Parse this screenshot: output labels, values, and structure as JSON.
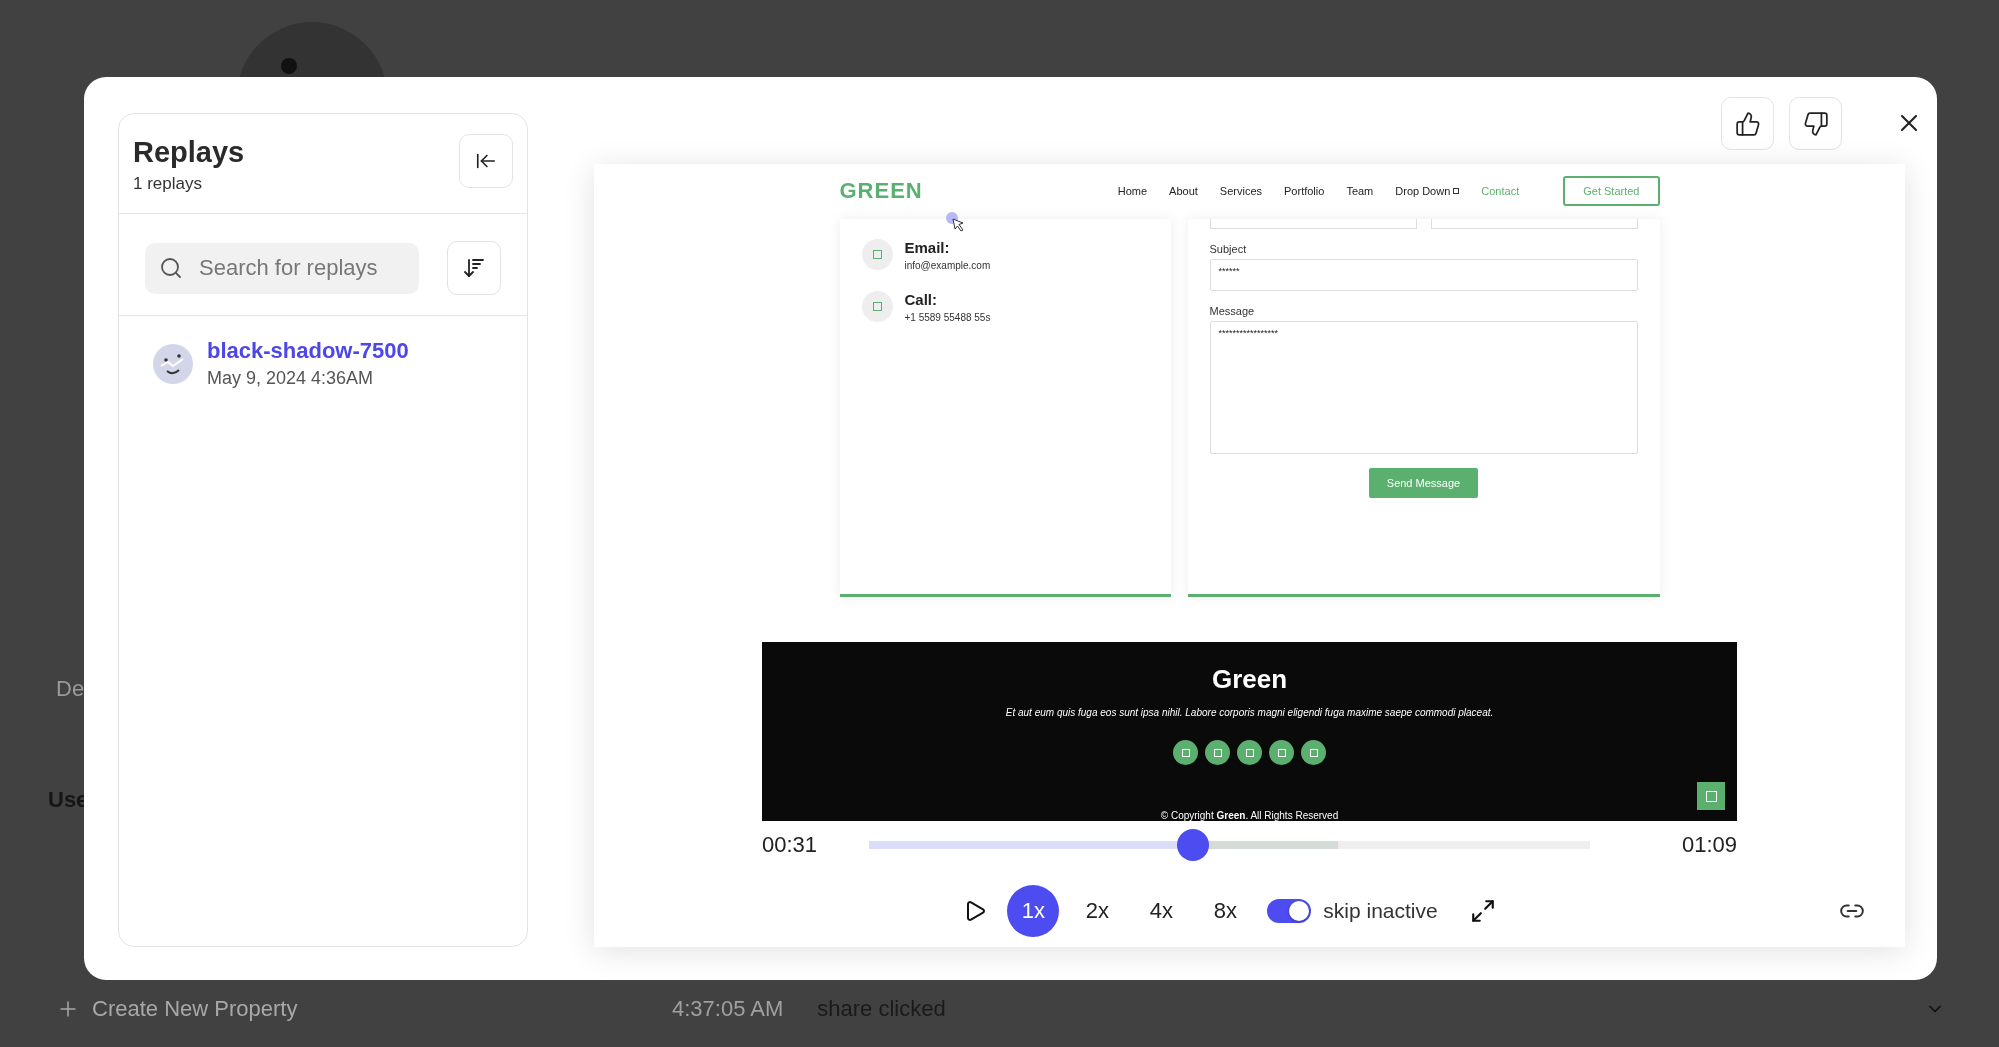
{
  "backdrop": {
    "section_fragments": [
      "De",
      "Use"
    ],
    "create_button": "Create New Property",
    "event": {
      "time": "4:37:05 AM",
      "name": "share clicked"
    }
  },
  "sidebar": {
    "title": "Replays",
    "count": "1 replays",
    "search": {
      "placeholder": "Search for replays"
    },
    "replays": [
      {
        "name": "black-shadow-7500",
        "date": "May 9, 2024 4:36AM",
        "selected": false
      }
    ]
  },
  "recording": {
    "site": {
      "logo": "GREEN",
      "nav": [
        {
          "label": "Home",
          "selected": false,
          "kind": "link"
        },
        {
          "label": "About",
          "selected": false,
          "kind": "link"
        },
        {
          "label": "Services",
          "selected": false,
          "kind": "link"
        },
        {
          "label": "Portfolio",
          "selected": false,
          "kind": "link"
        },
        {
          "label": "Team",
          "selected": false,
          "kind": "link"
        },
        {
          "label": "Drop Down",
          "selected": false,
          "kind": "dropdown"
        },
        {
          "label": "Contact",
          "selected": true,
          "kind": "link"
        }
      ],
      "cta": "Get Started",
      "contacts": [
        {
          "label": "Email:",
          "value": "info@example.com"
        },
        {
          "label": "Call:",
          "value": "+1 5589 55488 55s"
        }
      ],
      "form": {
        "fields": [
          {
            "label": "Subject",
            "value": "******",
            "kind": "input"
          },
          {
            "label": "Message",
            "value": "*****************",
            "kind": "textarea"
          }
        ],
        "submit": "Send Message"
      },
      "footer": {
        "title": "Green",
        "tagline": "Et aut eum quis fuga eos sunt ipsa nihil. Labore corporis magni eligendi fuga maxime saepe commodi placeat.",
        "copyright": "© Copyright **Green**. All Rights Reserved"
      }
    }
  },
  "player": {
    "current": "00:31",
    "total": "01:09",
    "played": {
      "level": 0.45
    },
    "buffered": {
      "level": 0.65
    },
    "speeds": [
      {
        "label": "1x",
        "selected": true
      },
      {
        "label": "2x",
        "selected": false
      },
      {
        "label": "4x",
        "selected": false
      },
      {
        "label": "8x",
        "selected": false
      }
    ],
    "skip_inactive": {
      "label": "skip inactive",
      "on": true
    }
  }
}
